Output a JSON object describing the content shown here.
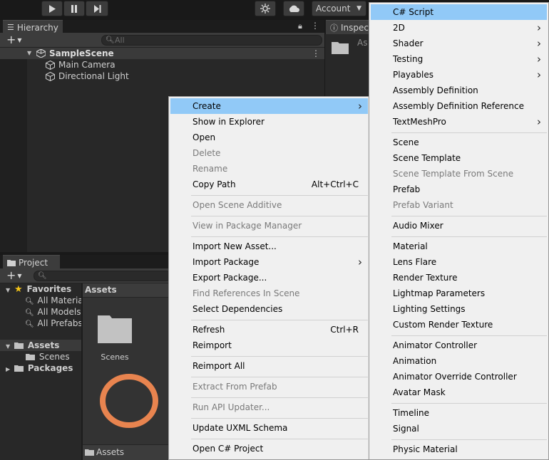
{
  "toolbar": {
    "account_label": "Account"
  },
  "hierarchy": {
    "tab_label": "Hierarchy",
    "search_placeholder": "All",
    "scene_name": "SampleScene",
    "items": [
      "Main Camera",
      "Directional Light"
    ]
  },
  "inspector": {
    "tab_label": "Inspec",
    "asset_label": "As"
  },
  "project": {
    "tab_label": "Project",
    "favorites_label": "Favorites",
    "favorites": [
      "All Materia",
      "All Models",
      "All Prefabs"
    ],
    "assets_label": "Assets",
    "scenes_label": "Scenes",
    "packages_label": "Packages",
    "grid_header": "Assets",
    "folder_label": "Scenes",
    "footer_path": "Assets"
  },
  "context_menu": {
    "items": [
      {
        "label": "Create",
        "submenu": true,
        "highlighted": true
      },
      {
        "label": "Show in Explorer"
      },
      {
        "label": "Open"
      },
      {
        "label": "Delete",
        "disabled": true
      },
      {
        "label": "Rename",
        "disabled": true
      },
      {
        "label": "Copy Path",
        "shortcut": "Alt+Ctrl+C"
      },
      {
        "label": "Open Scene Additive",
        "disabled": true
      },
      {
        "label": "View in Package Manager",
        "disabled": true
      },
      {
        "label": "Import New Asset..."
      },
      {
        "label": "Import Package",
        "submenu": true
      },
      {
        "label": "Export Package..."
      },
      {
        "label": "Find References In Scene",
        "disabled": true
      },
      {
        "label": "Select Dependencies"
      },
      {
        "label": "Refresh",
        "shortcut": "Ctrl+R"
      },
      {
        "label": "Reimport"
      },
      {
        "label": "Reimport All"
      },
      {
        "label": "Extract From Prefab",
        "disabled": true
      },
      {
        "label": "Run API Updater...",
        "disabled": true
      },
      {
        "label": "Update UXML Schema"
      },
      {
        "label": "Open C# Project"
      }
    ]
  },
  "create_menu": {
    "items": [
      {
        "label": "C# Script",
        "highlighted": true
      },
      {
        "label": "2D",
        "submenu": true
      },
      {
        "label": "Shader",
        "submenu": true
      },
      {
        "label": "Testing",
        "submenu": true
      },
      {
        "label": "Playables",
        "submenu": true
      },
      {
        "label": "Assembly Definition"
      },
      {
        "label": "Assembly Definition Reference"
      },
      {
        "label": "TextMeshPro",
        "submenu": true
      },
      {
        "label": "Scene"
      },
      {
        "label": "Scene Template"
      },
      {
        "label": "Scene Template From Scene",
        "disabled": true
      },
      {
        "label": "Prefab"
      },
      {
        "label": "Prefab Variant",
        "disabled": true
      },
      {
        "label": "Audio Mixer"
      },
      {
        "label": "Material"
      },
      {
        "label": "Lens Flare"
      },
      {
        "label": "Render Texture"
      },
      {
        "label": "Lightmap Parameters"
      },
      {
        "label": "Lighting Settings"
      },
      {
        "label": "Custom Render Texture"
      },
      {
        "label": "Animator Controller"
      },
      {
        "label": "Animation"
      },
      {
        "label": "Animator Override Controller"
      },
      {
        "label": "Avatar Mask"
      },
      {
        "label": "Timeline"
      },
      {
        "label": "Signal"
      },
      {
        "label": "Physic Material"
      }
    ]
  },
  "colors": {
    "highlight": "#91c9f7",
    "disabled_text": "#7a7a7a",
    "folder": "#c2c2c2",
    "ring": "#e8844f",
    "star": "#f5c518"
  }
}
